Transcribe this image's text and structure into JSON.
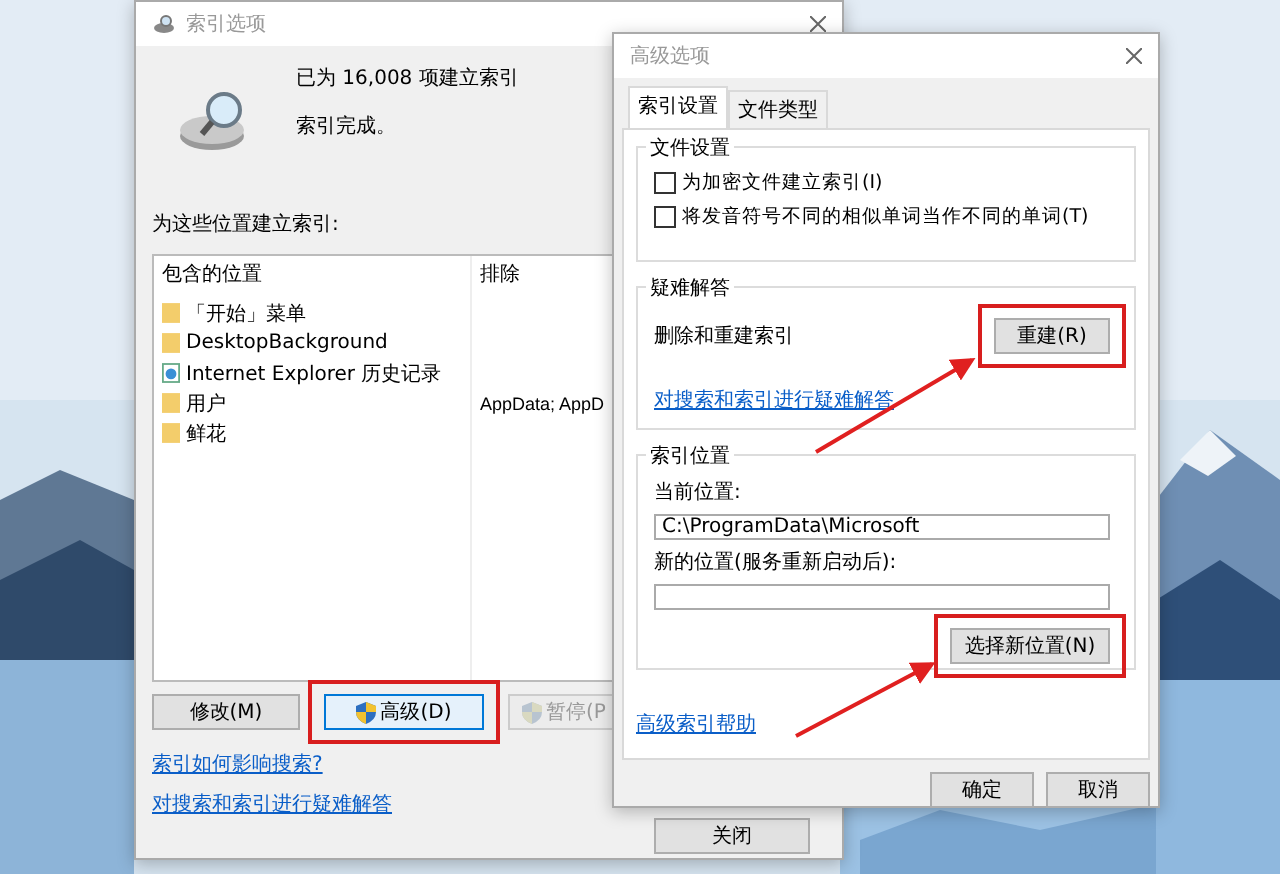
{
  "index_window": {
    "title": "索引选项",
    "status_count": "已为 16,008 项建立索引",
    "status_text": "索引完成。",
    "locations_label": "为这些位置建立索引:",
    "columns": [
      "包含的位置",
      "排除"
    ],
    "rows": [
      {
        "kind": "folder",
        "location": "「开始」菜单",
        "exclude": ""
      },
      {
        "kind": "folder",
        "location": "DesktopBackground",
        "exclude": ""
      },
      {
        "kind": "web",
        "location": "Internet Explorer 历史记录",
        "exclude": ""
      },
      {
        "kind": "folder",
        "location": "用户",
        "exclude": "AppData; AppD"
      },
      {
        "kind": "folder",
        "location": "鲜花",
        "exclude": ""
      }
    ],
    "buttons": [
      {
        "label": "修改(M)",
        "kind": "plain",
        "disabled": false
      },
      {
        "label": "高级(D)",
        "kind": "shield",
        "disabled": false
      },
      {
        "label": "暂停(P",
        "kind": "shield",
        "disabled": true
      }
    ],
    "links": [
      "索引如何影响搜索?",
      "对搜索和索引进行疑难解答"
    ],
    "close_button": "关闭"
  },
  "advanced_window": {
    "title": "高级选项",
    "tabs": [
      {
        "label": "索引设置",
        "selected": true
      },
      {
        "label": "文件类型",
        "selected": false
      }
    ],
    "file_settings": {
      "title": "文件设置",
      "options": [
        {
          "label": "为加密文件建立索引(I)",
          "checked": false
        },
        {
          "label": "将发音符号不同的相似单词当作不同的单词(T)",
          "checked": false
        }
      ]
    },
    "troubleshooting": {
      "title": "疑难解答",
      "text": "删除和重建索引",
      "button": "重建(R)",
      "link": "对搜索和索引进行疑难解答"
    },
    "index_location": {
      "title": "索引位置",
      "current_label": "当前位置:",
      "current_value": "C:\\ProgramData\\Microsoft",
      "new_label": "新的位置(服务重新启动后):",
      "button": "选择新位置(N)"
    },
    "help_link": "高级索引帮助",
    "buttons": [
      "确定",
      "取消"
    ]
  }
}
